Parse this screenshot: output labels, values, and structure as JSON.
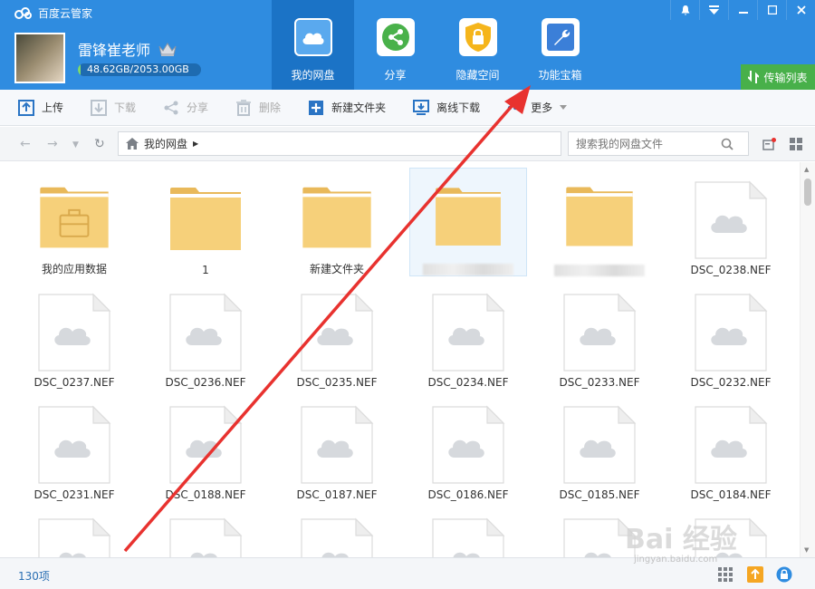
{
  "app": {
    "title": "百度云管家"
  },
  "window_buttons": [
    "notify-icon",
    "menu-icon",
    "minimize-icon",
    "maximize-icon",
    "close-icon"
  ],
  "user": {
    "name": "雷锋崔老师",
    "quota_text": "48.62GB/2053.00GB",
    "quota_used_fraction": 0.024
  },
  "nav": {
    "tabs": [
      {
        "label": "我的网盘",
        "icon": "cloud-icon",
        "active": true
      },
      {
        "label": "分享",
        "icon": "share-icon",
        "active": false
      },
      {
        "label": "隐藏空间",
        "icon": "lock-shield-icon",
        "active": false
      },
      {
        "label": "功能宝箱",
        "icon": "wrench-icon",
        "active": false
      }
    ],
    "transfer_label": "传输列表"
  },
  "toolbar": {
    "upload": "上传",
    "download": "下载",
    "share": "分享",
    "delete": "删除",
    "new_folder": "新建文件夹",
    "offline_download": "离线下载",
    "more": "更多"
  },
  "address": {
    "path": "我的网盘",
    "search_placeholder": "搜索我的网盘文件"
  },
  "files": [
    {
      "name": "我的应用数据",
      "type": "folder-app"
    },
    {
      "name": "1",
      "type": "folder"
    },
    {
      "name": "新建文件夹",
      "type": "folder"
    },
    {
      "name": "",
      "type": "folder",
      "blurred": true,
      "selected": true
    },
    {
      "name": "",
      "type": "folder",
      "blurred": true
    },
    {
      "name": "DSC_0238.NEF",
      "type": "file"
    },
    {
      "name": "DSC_0237.NEF",
      "type": "file"
    },
    {
      "name": "DSC_0236.NEF",
      "type": "file"
    },
    {
      "name": "DSC_0235.NEF",
      "type": "file"
    },
    {
      "name": "DSC_0234.NEF",
      "type": "file"
    },
    {
      "name": "DSC_0233.NEF",
      "type": "file"
    },
    {
      "name": "DSC_0232.NEF",
      "type": "file"
    },
    {
      "name": "DSC_0231.NEF",
      "type": "file"
    },
    {
      "name": "DSC_0188.NEF",
      "type": "file"
    },
    {
      "name": "DSC_0187.NEF",
      "type": "file"
    },
    {
      "name": "DSC_0186.NEF",
      "type": "file"
    },
    {
      "name": "DSC_0185.NEF",
      "type": "file"
    },
    {
      "name": "DSC_0184.NEF",
      "type": "file"
    },
    {
      "name": "",
      "type": "file"
    },
    {
      "name": "",
      "type": "file"
    },
    {
      "name": "",
      "type": "file"
    },
    {
      "name": "",
      "type": "file"
    },
    {
      "name": "",
      "type": "file"
    },
    {
      "name": "",
      "type": "file"
    }
  ],
  "status": {
    "count": "130项"
  },
  "watermark": {
    "text": "Bai 经验",
    "sub": "jingyan.baidu.com"
  },
  "colors": {
    "header": "#2f8ce0",
    "active_tab": "#1b73c6",
    "transfer": "#48b04a",
    "folder": "#f6d07a",
    "arrow": "#e8322f"
  }
}
